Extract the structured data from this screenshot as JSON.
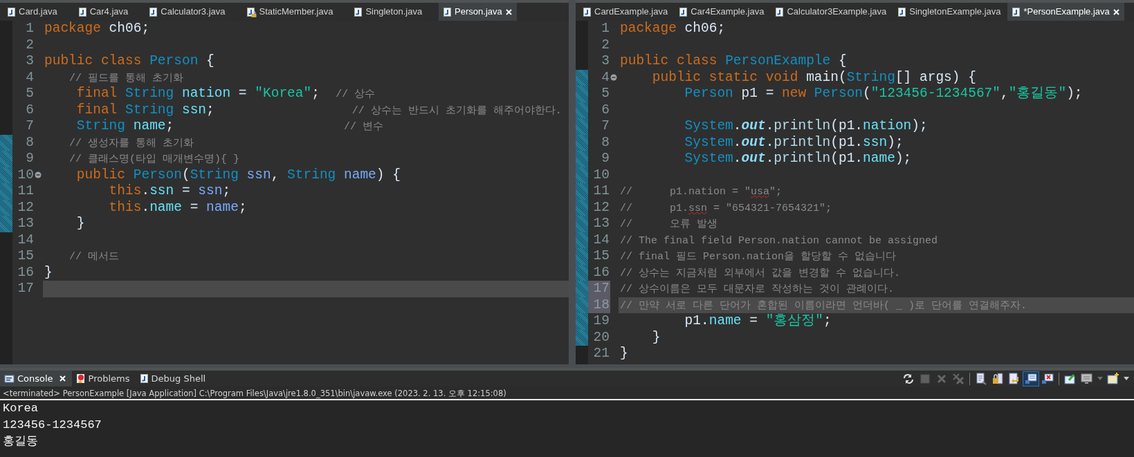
{
  "editors": [
    {
      "tabs": [
        {
          "label": "Card.java",
          "kind": "java",
          "selected": false
        },
        {
          "label": "Car4.java",
          "kind": "java",
          "selected": false
        },
        {
          "label": "Calculator3.java",
          "kind": "java",
          "selected": false
        },
        {
          "label": "StaticMember.java",
          "kind": "java-locked",
          "selected": false
        },
        {
          "label": "Singleton.java",
          "kind": "java",
          "selected": false
        },
        {
          "label": "Person.java",
          "kind": "java",
          "selected": true
        }
      ],
      "lines": [
        {
          "number": "1",
          "current": false,
          "changed": false,
          "fold": false,
          "selected": false,
          "tokens": [
            {
              "kind": "kw",
              "text": "package"
            },
            {
              "kind": "plain",
              "text": " ch06;"
            }
          ]
        },
        {
          "number": "2",
          "current": false,
          "changed": false,
          "fold": false,
          "selected": false
        },
        {
          "number": "3",
          "current": false,
          "changed": false,
          "fold": false,
          "selected": false,
          "tokens": [
            {
              "kind": "kw",
              "text": "public class "
            },
            {
              "kind": "type",
              "text": "Person"
            },
            {
              "kind": "plain",
              "text": " {"
            }
          ]
        },
        {
          "number": "4",
          "current": false,
          "changed": false,
          "fold": false,
          "selected": false,
          "tokens": [
            {
              "kind": "comment",
              "text": "    // 필드를 통해 초기화"
            }
          ]
        },
        {
          "number": "5",
          "current": false,
          "changed": false,
          "fold": false,
          "selected": false,
          "tokens": [
            {
              "kind": "kw",
              "text": "    final "
            },
            {
              "kind": "type",
              "text": "String "
            },
            {
              "kind": "field",
              "text": "nation"
            },
            {
              "kind": "plain",
              "text": " = "
            },
            {
              "kind": "str",
              "text": "\"Korea\""
            },
            {
              "kind": "plain",
              "text": ";  "
            },
            {
              "kind": "comment",
              "text": "// 상수"
            }
          ]
        },
        {
          "number": "6",
          "current": false,
          "changed": false,
          "fold": false,
          "selected": false,
          "tokens": [
            {
              "kind": "kw",
              "text": "    final "
            },
            {
              "kind": "type",
              "text": "String "
            },
            {
              "kind": "field",
              "text": "ssn"
            },
            {
              "kind": "plain",
              "text": ";                 "
            },
            {
              "kind": "comment",
              "text": "// 상수는 반드시 초기화를 해주어야한다."
            }
          ]
        },
        {
          "number": "7",
          "current": false,
          "changed": false,
          "fold": false,
          "selected": false,
          "tokens": [
            {
              "kind": "type",
              "text": "    String "
            },
            {
              "kind": "field",
              "text": "name"
            },
            {
              "kind": "plain",
              "text": ";                     "
            },
            {
              "kind": "comment",
              "text": "// 변수"
            }
          ]
        },
        {
          "number": "8",
          "current": false,
          "changed": true,
          "fold": false,
          "selected": false,
          "tokens": [
            {
              "kind": "comment",
              "text": "    // 생성자를 통해 초기화"
            }
          ]
        },
        {
          "number": "9",
          "current": false,
          "changed": true,
          "fold": false,
          "selected": false,
          "tokens": [
            {
              "kind": "comment",
              "text": "    // 클래스명(타입 매개변수명){ }"
            }
          ]
        },
        {
          "number": "10",
          "current": false,
          "changed": true,
          "fold": true,
          "selected": false,
          "tokens": [
            {
              "kind": "kw",
              "text": "    public "
            },
            {
              "kind": "type",
              "text": "Person"
            },
            {
              "kind": "plain",
              "text": "("
            },
            {
              "kind": "type",
              "text": "String "
            },
            {
              "kind": "param",
              "text": "ssn"
            },
            {
              "kind": "plain",
              "text": ", "
            },
            {
              "kind": "type",
              "text": "String "
            },
            {
              "kind": "param",
              "text": "name"
            },
            {
              "kind": "plain",
              "text": ") {"
            }
          ]
        },
        {
          "number": "11",
          "current": false,
          "changed": true,
          "fold": false,
          "selected": false,
          "tokens": [
            {
              "kind": "kw",
              "text": "        this"
            },
            {
              "kind": "plain",
              "text": "."
            },
            {
              "kind": "field",
              "text": "ssn"
            },
            {
              "kind": "plain",
              "text": " = "
            },
            {
              "kind": "param",
              "text": "ssn"
            },
            {
              "kind": "plain",
              "text": ";"
            }
          ]
        },
        {
          "number": "12",
          "current": false,
          "changed": true,
          "fold": false,
          "selected": false,
          "tokens": [
            {
              "kind": "kw",
              "text": "        this"
            },
            {
              "kind": "plain",
              "text": "."
            },
            {
              "kind": "field",
              "text": "name"
            },
            {
              "kind": "plain",
              "text": " = "
            },
            {
              "kind": "param",
              "text": "name"
            },
            {
              "kind": "plain",
              "text": ";"
            }
          ]
        },
        {
          "number": "13",
          "current": false,
          "changed": true,
          "fold": false,
          "selected": false,
          "tokens": [
            {
              "kind": "plain",
              "text": "    }"
            }
          ]
        },
        {
          "number": "14",
          "current": false,
          "changed": false,
          "fold": false,
          "selected": false
        },
        {
          "number": "15",
          "current": false,
          "changed": false,
          "fold": false,
          "selected": false,
          "tokens": [
            {
              "kind": "comment",
              "text": "    // 메서드"
            }
          ]
        },
        {
          "number": "16",
          "current": false,
          "changed": false,
          "fold": false,
          "selected": false,
          "tokens": [
            {
              "kind": "plain",
              "text": "}"
            }
          ]
        },
        {
          "number": "17",
          "current": true,
          "changed": false,
          "fold": false,
          "selected": false
        }
      ]
    },
    {
      "tabs": [
        {
          "label": "CardExample.java",
          "kind": "java",
          "selected": false
        },
        {
          "label": "Car4Example.java",
          "kind": "java",
          "selected": false
        },
        {
          "label": "Calculator3Example.java",
          "kind": "java",
          "selected": false
        },
        {
          "label": "SingletonExample.java",
          "kind": "java",
          "selected": false
        },
        {
          "label": "*PersonExample.java",
          "kind": "java",
          "selected": true
        }
      ],
      "lines": [
        {
          "number": "1",
          "current": false,
          "changed": false,
          "fold": false,
          "selected": false,
          "tokens": [
            {
              "kind": "kw",
              "text": "package"
            },
            {
              "kind": "plain",
              "text": " ch06;"
            }
          ]
        },
        {
          "number": "2",
          "current": false,
          "changed": false,
          "fold": false,
          "selected": false
        },
        {
          "number": "3",
          "current": false,
          "changed": false,
          "fold": false,
          "selected": false,
          "tokens": [
            {
              "kind": "kw",
              "text": "public class "
            },
            {
              "kind": "type",
              "text": "PersonExample"
            },
            {
              "kind": "plain",
              "text": " {"
            }
          ]
        },
        {
          "number": "4",
          "current": false,
          "changed": true,
          "fold": true,
          "selected": false,
          "tokens": [
            {
              "kind": "kw",
              "text": "    public static void "
            },
            {
              "kind": "plain",
              "text": "main("
            },
            {
              "kind": "type",
              "text": "String"
            },
            {
              "kind": "plain",
              "text": "[] args) {"
            }
          ]
        },
        {
          "number": "5",
          "current": false,
          "changed": true,
          "fold": false,
          "selected": false,
          "tokens": [
            {
              "kind": "type",
              "text": "        Person "
            },
            {
              "kind": "plain",
              "text": "p1 = "
            },
            {
              "kind": "kw",
              "text": "new "
            },
            {
              "kind": "type",
              "text": "Person"
            },
            {
              "kind": "plain",
              "text": "("
            },
            {
              "kind": "str",
              "text": "\"123456-1234567\""
            },
            {
              "kind": "plain",
              "text": ","
            },
            {
              "kind": "str",
              "text": "\"홍길동\""
            },
            {
              "kind": "plain",
              "text": ");"
            }
          ]
        },
        {
          "number": "6",
          "current": false,
          "changed": true,
          "fold": false,
          "selected": false
        },
        {
          "number": "7",
          "current": false,
          "changed": true,
          "fold": false,
          "selected": false,
          "tokens": [
            {
              "kind": "type",
              "text": "        System"
            },
            {
              "kind": "plain",
              "text": "."
            },
            {
              "kind": "static",
              "text": "out"
            },
            {
              "kind": "plain",
              "text": "."
            },
            {
              "kind": "method",
              "text": "println"
            },
            {
              "kind": "plain",
              "text": "(p1."
            },
            {
              "kind": "field",
              "text": "nation"
            },
            {
              "kind": "plain",
              "text": ");"
            }
          ]
        },
        {
          "number": "8",
          "current": false,
          "changed": true,
          "fold": false,
          "selected": false,
          "tokens": [
            {
              "kind": "type",
              "text": "        System"
            },
            {
              "kind": "plain",
              "text": "."
            },
            {
              "kind": "static",
              "text": "out"
            },
            {
              "kind": "plain",
              "text": "."
            },
            {
              "kind": "method",
              "text": "println"
            },
            {
              "kind": "plain",
              "text": "(p1."
            },
            {
              "kind": "field",
              "text": "ssn"
            },
            {
              "kind": "plain",
              "text": ");"
            }
          ]
        },
        {
          "number": "9",
          "current": false,
          "changed": true,
          "fold": false,
          "selected": false,
          "tokens": [
            {
              "kind": "type",
              "text": "        System"
            },
            {
              "kind": "plain",
              "text": "."
            },
            {
              "kind": "static",
              "text": "out"
            },
            {
              "kind": "plain",
              "text": "."
            },
            {
              "kind": "method",
              "text": "println"
            },
            {
              "kind": "plain",
              "text": "(p1."
            },
            {
              "kind": "field",
              "text": "name"
            },
            {
              "kind": "plain",
              "text": ");"
            }
          ]
        },
        {
          "number": "10",
          "current": false,
          "changed": true,
          "fold": false,
          "selected": false
        },
        {
          "number": "11",
          "current": false,
          "changed": true,
          "fold": false,
          "selected": false,
          "tokens": [
            {
              "kind": "comment",
              "text": "//      p1.nation = \""
            },
            {
              "kind": "misspelled",
              "text": "usa"
            },
            {
              "kind": "comment",
              "text": "\";"
            }
          ]
        },
        {
          "number": "12",
          "current": false,
          "changed": true,
          "fold": false,
          "selected": false,
          "tokens": [
            {
              "kind": "comment",
              "text": "//      p1."
            },
            {
              "kind": "misspelled",
              "text": "ssn"
            },
            {
              "kind": "comment",
              "text": " = \"654321-7654321\";"
            }
          ]
        },
        {
          "number": "13",
          "current": false,
          "changed": true,
          "fold": false,
          "selected": false,
          "tokens": [
            {
              "kind": "comment",
              "text": "//      오류 발생"
            }
          ]
        },
        {
          "number": "14",
          "current": false,
          "changed": true,
          "fold": false,
          "selected": false,
          "tokens": [
            {
              "kind": "comment",
              "text": "// The final field Person.nation cannot be assigned"
            }
          ]
        },
        {
          "number": "15",
          "current": false,
          "changed": true,
          "fold": false,
          "selected": false,
          "tokens": [
            {
              "kind": "comment",
              "text": "// final 필드 Person.nation을 할당할 수 없습니다"
            }
          ]
        },
        {
          "number": "16",
          "current": false,
          "changed": true,
          "fold": false,
          "selected": false,
          "tokens": [
            {
              "kind": "comment",
              "text": "// 상수는 지금처럼 외부에서 값을 변경할 수 없습니다."
            }
          ]
        },
        {
          "number": "17",
          "current": false,
          "changed": true,
          "fold": false,
          "selected": true,
          "tokens": [
            {
              "kind": "comment",
              "text": "// 상수이름은 모두 대문자로 작성하는 것이 관례이다."
            }
          ]
        },
        {
          "number": "18",
          "current": true,
          "changed": true,
          "fold": false,
          "selected": true,
          "tokens": [
            {
              "kind": "comment",
              "text": "// 만약 서로 다른 단어가 혼합된 이름이라면 언더바( _ )로 단어를 연결해주자."
            }
          ]
        },
        {
          "number": "19",
          "current": false,
          "changed": true,
          "fold": false,
          "selected": false,
          "tokens": [
            {
              "kind": "plain",
              "text": "        p1."
            },
            {
              "kind": "field",
              "text": "name"
            },
            {
              "kind": "plain",
              "text": " = "
            },
            {
              "kind": "str",
              "text": "\"홍삼정\""
            },
            {
              "kind": "plain",
              "text": ";"
            }
          ]
        },
        {
          "number": "20",
          "current": false,
          "changed": true,
          "fold": false,
          "selected": false,
          "tokens": [
            {
              "kind": "plain",
              "text": "    }"
            }
          ]
        },
        {
          "number": "21",
          "current": false,
          "changed": false,
          "fold": false,
          "selected": false,
          "tokens": [
            {
              "kind": "plain",
              "text": "}"
            }
          ]
        }
      ]
    }
  ],
  "console": {
    "tabs": [
      {
        "label": "Console",
        "kind": "console",
        "selected": true
      },
      {
        "label": "Problems",
        "kind": "problems",
        "selected": false
      },
      {
        "label": "Debug Shell",
        "kind": "debug-shell",
        "selected": false
      }
    ],
    "toolbar": [
      {
        "kind": "sync",
        "disabled": false,
        "pressed": false
      },
      {
        "kind": "stop",
        "disabled": true,
        "pressed": false
      },
      {
        "kind": "remove",
        "disabled": true,
        "pressed": false
      },
      {
        "kind": "remove-all",
        "disabled": true,
        "pressed": false
      },
      {
        "kind": "separator"
      },
      {
        "kind": "clear",
        "disabled": false,
        "pressed": false
      },
      {
        "kind": "scroll-lock",
        "disabled": false,
        "pressed": false
      },
      {
        "kind": "word-wrap",
        "disabled": false,
        "pressed": false
      },
      {
        "kind": "show-output",
        "disabled": false,
        "pressed": true
      },
      {
        "kind": "show-error",
        "disabled": false,
        "pressed": false
      },
      {
        "kind": "separator"
      },
      {
        "kind": "pin",
        "disabled": false,
        "pressed": false
      },
      {
        "kind": "display",
        "disabled": false,
        "pressed": false
      },
      {
        "kind": "dropdown",
        "disabled": true,
        "pressed": false
      },
      {
        "kind": "new-console",
        "disabled": false,
        "pressed": false
      },
      {
        "kind": "dropdown",
        "disabled": false,
        "pressed": false
      }
    ],
    "status": "<terminated> PersonExample [Java Application] C:\\Program Files\\Java\\jre1.8.0_351\\bin\\javaw.exe (2023. 2. 13. 오후 12:15:08)",
    "output": [
      "Korea",
      "123456-1234567",
      "홍길동"
    ]
  }
}
